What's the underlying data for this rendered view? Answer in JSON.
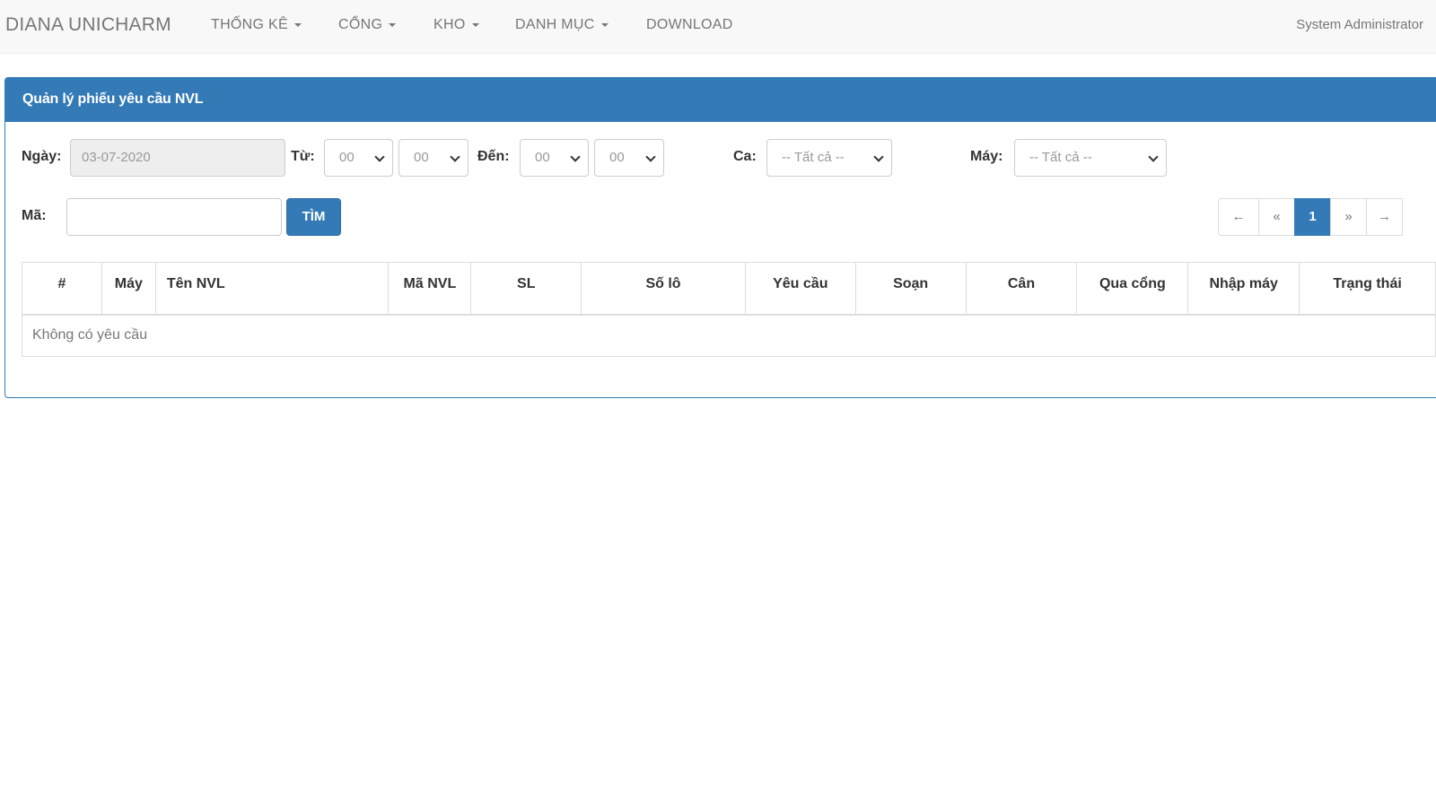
{
  "navbar": {
    "brand": "DIANA UNICHARM",
    "menu": [
      {
        "label": "THỐNG KÊ",
        "dropdown": true
      },
      {
        "label": "CỔNG",
        "dropdown": true
      },
      {
        "label": "KHO",
        "dropdown": true
      },
      {
        "label": "DANH MỤC",
        "dropdown": true
      },
      {
        "label": "DOWNLOAD",
        "dropdown": false
      }
    ],
    "user": "System Administrator"
  },
  "panel": {
    "title": "Quản lý phiếu yêu cầu NVL"
  },
  "filters": {
    "date_label": "Ngày:",
    "date_value": "03-07-2020",
    "from_label": "Từ:",
    "from_hour": "00",
    "from_minute": "00",
    "to_label": "Đến:",
    "to_hour": "00",
    "to_minute": "00",
    "shift_label": "Ca:",
    "shift_value": "-- Tất cả --",
    "machine_label": "Máy:",
    "machine_value": "-- Tất cả --",
    "code_label": "Mã:",
    "code_value": "",
    "search_button": "TÌM"
  },
  "pagination": {
    "first": "←",
    "prev": "«",
    "current": "1",
    "next": "»",
    "last": "→"
  },
  "table": {
    "columns": [
      "#",
      "Máy",
      "Tên NVL",
      "Mã NVL",
      "SL",
      "Số lô",
      "Yêu cầu",
      "Soạn",
      "Cân",
      "Qua cổng",
      "Nhập máy",
      "Trạng thái"
    ],
    "empty_message": "Không có yêu cầu"
  }
}
